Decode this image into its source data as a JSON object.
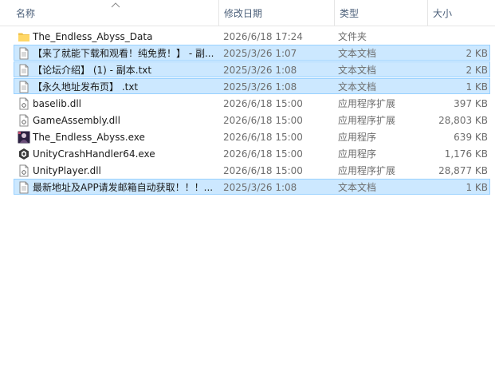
{
  "columns": {
    "name": "名称",
    "date": "修改日期",
    "type": "类型",
    "size": "大小"
  },
  "files": [
    {
      "name": "The_Endless_Abyss_Data",
      "date": "2026/6/18 17:24",
      "type": "文件夹",
      "size": "",
      "icon": "folder-icon",
      "selected": false
    },
    {
      "name": "【来了就能下载和观看！纯免费！】 - 副...",
      "date": "2025/3/26 1:07",
      "type": "文本文档",
      "size": "2 KB",
      "icon": "text-file-icon",
      "selected": true
    },
    {
      "name": "【论坛介绍】 (1) - 副本.txt",
      "date": "2025/3/26 1:08",
      "type": "文本文档",
      "size": "2 KB",
      "icon": "text-file-icon",
      "selected": true
    },
    {
      "name": "【永久地址发布页】 .txt",
      "date": "2025/3/26 1:08",
      "type": "文本文档",
      "size": "1 KB",
      "icon": "text-file-icon",
      "selected": true
    },
    {
      "name": "baselib.dll",
      "date": "2026/6/18 15:00",
      "type": "应用程序扩展",
      "size": "397 KB",
      "icon": "dll-file-icon",
      "selected": false
    },
    {
      "name": "GameAssembly.dll",
      "date": "2026/6/18 15:00",
      "type": "应用程序扩展",
      "size": "28,803 KB",
      "icon": "dll-file-icon",
      "selected": false
    },
    {
      "name": "The_Endless_Abyss.exe",
      "date": "2026/6/18 15:00",
      "type": "应用程序",
      "size": "639 KB",
      "icon": "game-app-icon",
      "selected": false
    },
    {
      "name": "UnityCrashHandler64.exe",
      "date": "2026/6/18 15:00",
      "type": "应用程序",
      "size": "1,176 KB",
      "icon": "unity-app-icon",
      "selected": false
    },
    {
      "name": "UnityPlayer.dll",
      "date": "2026/6/18 15:00",
      "type": "应用程序扩展",
      "size": "28,877 KB",
      "icon": "dll-file-icon",
      "selected": false
    },
    {
      "name": "最新地址及APP请发邮箱自动获取！！！...",
      "date": "2025/3/26 1:08",
      "type": "文本文档",
      "size": "1 KB",
      "icon": "text-file-icon",
      "selected": true
    }
  ]
}
